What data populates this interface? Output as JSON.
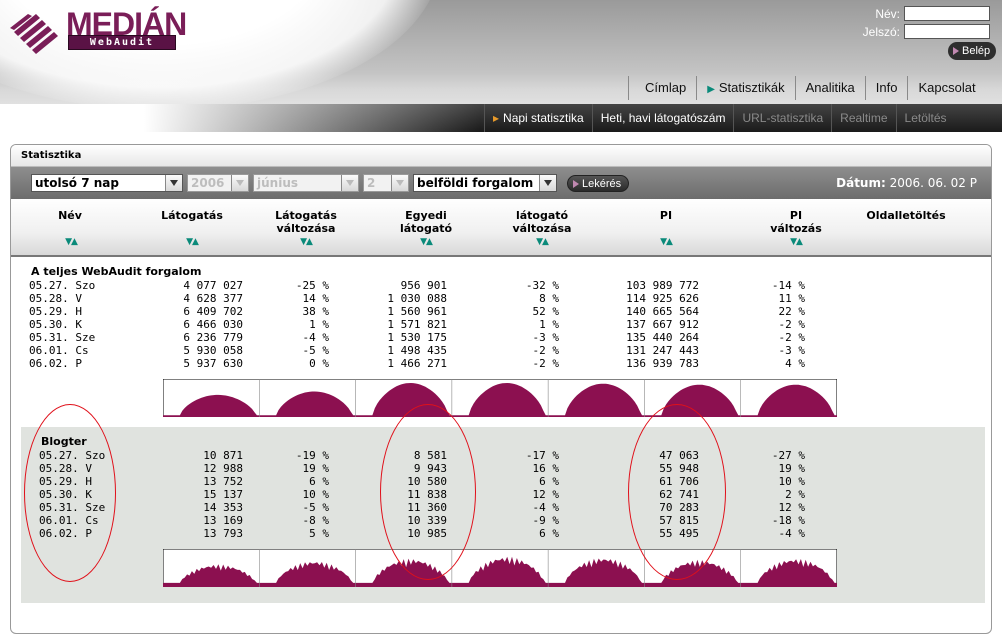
{
  "brand": {
    "name": "MEDIÁN",
    "sub": "WebAudit"
  },
  "login": {
    "name_label": "Név:",
    "name_value": "",
    "pass_label": "Jelszó:",
    "pass_value": "",
    "button": "Belép"
  },
  "nav_main": [
    "Címlap",
    "Statisztikák",
    "Analitika",
    "Info",
    "Kapcsolat"
  ],
  "nav_sub": [
    {
      "label": "Napi statisztika",
      "state": "active"
    },
    {
      "label": "Heti, havi látogatószám",
      "state": "normal"
    },
    {
      "label": "URL-statisztika",
      "state": "disabled"
    },
    {
      "label": "Realtime",
      "state": "disabled"
    },
    {
      "label": "Letöltés",
      "state": "disabled"
    }
  ],
  "panel_title": "Statisztika",
  "controls": {
    "period": "utolsó 7 nap",
    "year": "2006",
    "month": "június",
    "day": "2",
    "scope": "belföldi forgalom",
    "button": "Lekérés",
    "date_label": "Dátum:",
    "date_value": "2006. 06. 02 P"
  },
  "columns": [
    {
      "l1": "Név",
      "l2": ""
    },
    {
      "l1": "Látogatás",
      "l2": ""
    },
    {
      "l1": "Látogatás",
      "l2": "változása"
    },
    {
      "l1": "Egyedi",
      "l2": "látogató"
    },
    {
      "l1": "látogató",
      "l2": "változása"
    },
    {
      "l1": "PI",
      "l2": ""
    },
    {
      "l1": "PI",
      "l2": "változás"
    },
    {
      "l1": "Oldalletöltés",
      "l2": ""
    }
  ],
  "sort_icon": "sort-down-up-icon",
  "sort_glyph": "▼▲",
  "blocks": [
    {
      "title": "A teljes WebAudit forgalom",
      "rows": [
        [
          "05.27. Szo",
          "4 077 027",
          "-25 %",
          "956 901",
          "-32 %",
          "103 989 772",
          "-14 %"
        ],
        [
          "05.28. V",
          "4 628 377",
          "14 %",
          "1 030 088",
          "8 %",
          "114 925 626",
          "11 %"
        ],
        [
          "05.29. H",
          "6 409 702",
          "38 %",
          "1 560 961",
          "52 %",
          "140 665 564",
          "22 %"
        ],
        [
          "05.30. K",
          "6 466 030",
          "1 %",
          "1 571 821",
          "1 %",
          "137 667 912",
          "-2 %"
        ],
        [
          "05.31. Sze",
          "6 236 779",
          "-4 %",
          "1 530 175",
          "-3 %",
          "135 440 264",
          "-2 %"
        ],
        [
          "06.01. Cs",
          "5 930 058",
          "-5 %",
          "1 498 435",
          "-2 %",
          "131 247 443",
          "-3 %"
        ],
        [
          "06.02. P",
          "5 937 630",
          "0 %",
          "1 466 271",
          "-2 %",
          "136 939 783",
          "4 %"
        ]
      ]
    },
    {
      "title": "Blogter",
      "rows": [
        [
          "05.27. Szo",
          "10 871",
          "-19 %",
          "8 581",
          "-17 %",
          "47 063",
          "-27 %"
        ],
        [
          "05.28. V",
          "12 988",
          "19 %",
          "9 943",
          "16 %",
          "55 948",
          "19 %"
        ],
        [
          "05.29. H",
          "13 752",
          "6 %",
          "10 580",
          "6 %",
          "61 706",
          "10 %"
        ],
        [
          "05.30. K",
          "15 137",
          "10 %",
          "11 838",
          "12 %",
          "62 741",
          "2 %"
        ],
        [
          "05.31. Sze",
          "14 353",
          "-5 %",
          "11 360",
          "-4 %",
          "70 283",
          "12 %"
        ],
        [
          "06.01. Cs",
          "13 169",
          "-8 %",
          "10 339",
          "-9 %",
          "57 815",
          "-18 %"
        ],
        [
          "06.02. P",
          "13 793",
          "5 %",
          "10 985",
          "6 %",
          "55 495",
          "-4 %"
        ]
      ]
    }
  ],
  "colors": {
    "brand": "#7a1e58",
    "chart_fill": "#8c1050",
    "annotation": "#e0101a",
    "highlight_bg": "#e0e3df"
  }
}
